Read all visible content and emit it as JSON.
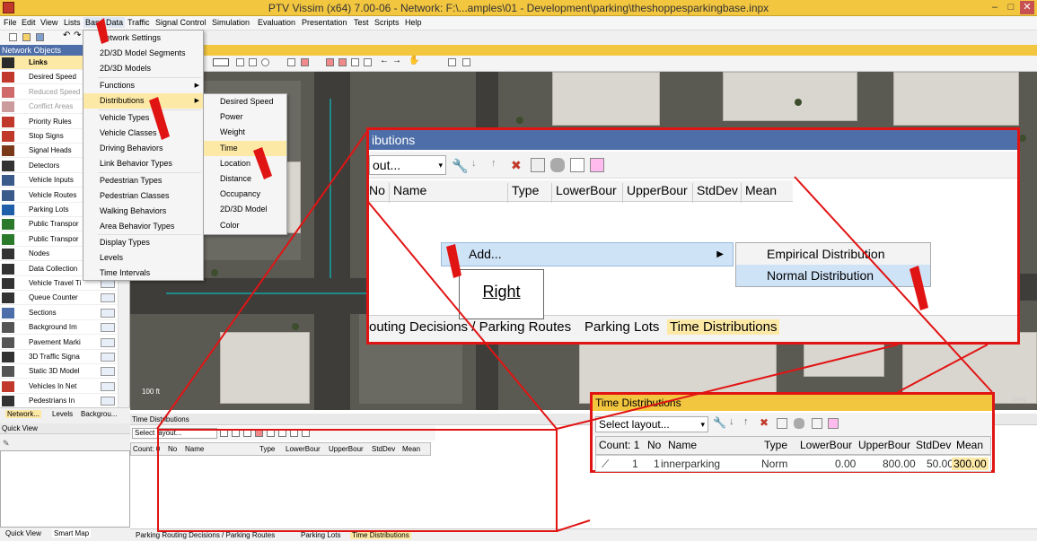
{
  "window": {
    "title": "PTV Vissim (x64) 7.00-06 - Network: F:\\...amples\\01 - Development\\parking\\theshoppesparkingbase.inpx",
    "buttons": [
      "–",
      "□",
      "✕"
    ]
  },
  "menubar": [
    "File",
    "Edit",
    "View",
    "Lists",
    "Base Data",
    "Traffic",
    "Signal Control",
    "Simulation",
    "Evaluation",
    "Presentation",
    "Test",
    "Scripts",
    "Help"
  ],
  "network_objects": {
    "title": "Network Objects",
    "items": [
      {
        "label": "Links",
        "icon": "links-icon",
        "bold": true
      },
      {
        "label": "Desired Speed",
        "icon": "speed-sign-icon"
      },
      {
        "label": "Reduced Speed",
        "icon": "reduced-speed-icon",
        "dim": true
      },
      {
        "label": "Conflict Areas",
        "icon": "conflict-area-icon",
        "dim": true
      },
      {
        "label": "Priority Rules",
        "icon": "priority-rule-icon"
      },
      {
        "label": "Stop Signs",
        "icon": "stop-sign-icon"
      },
      {
        "label": "Signal Heads",
        "icon": "signal-head-icon"
      },
      {
        "label": "Detectors",
        "icon": "detector-icon"
      },
      {
        "label": "Vehicle Inputs",
        "icon": "vehicle-input-icon"
      },
      {
        "label": "Vehicle Routes",
        "icon": "vehicle-route-icon"
      },
      {
        "label": "Parking Lots",
        "icon": "parking-icon"
      },
      {
        "label": "Public Transpor",
        "icon": "public-transport-stop-icon"
      },
      {
        "label": "Public Transpor",
        "icon": "public-transport-line-icon"
      },
      {
        "label": "Nodes",
        "icon": "node-icon"
      },
      {
        "label": "Data Collection",
        "icon": "data-collection-icon"
      },
      {
        "label": "Vehicle Travel Ti",
        "icon": "travel-time-icon"
      },
      {
        "label": "Queue Counter",
        "icon": "queue-counter-icon"
      },
      {
        "label": "Sections",
        "icon": "section-icon"
      },
      {
        "label": "Background Im",
        "icon": "background-image-icon"
      },
      {
        "label": "Pavement Marki",
        "icon": "pavement-marking-icon"
      },
      {
        "label": "3D Traffic Signa",
        "icon": "traffic-signal-3d-icon"
      },
      {
        "label": "Static 3D Model",
        "icon": "static-3d-model-icon"
      },
      {
        "label": "Vehicles In Net",
        "icon": "vehicles-in-net-icon"
      },
      {
        "label": "Pedestrians In",
        "icon": "pedestrians-in-net-icon"
      }
    ],
    "tabs": [
      "Network...",
      "Levels",
      "Backgrou..."
    ]
  },
  "quick_view": {
    "title": "Quick View",
    "tabs": [
      "Quick View",
      "Smart Map"
    ]
  },
  "base_data_menu": {
    "items": [
      {
        "label": "Network Settings"
      },
      {
        "label": "2D/3D Model Segments"
      },
      {
        "label": "2D/3D Models"
      },
      {
        "label": "Functions",
        "submenu": true
      },
      {
        "label": "Distributions",
        "submenu": true,
        "highlighted": true
      },
      {
        "label": "Vehicle Types"
      },
      {
        "label": "Vehicle Classes"
      },
      {
        "label": "Driving Behaviors"
      },
      {
        "label": "Link Behavior Types"
      },
      {
        "label": "Pedestrian Types"
      },
      {
        "label": "Pedestrian Classes"
      },
      {
        "label": "Walking Behaviors"
      },
      {
        "label": "Area Behavior Types"
      },
      {
        "label": "Display Types"
      },
      {
        "label": "Levels"
      },
      {
        "label": "Time Intervals"
      }
    ]
  },
  "distributions_menu": {
    "items": [
      "Desired Speed",
      "Power",
      "Weight",
      "Time",
      "Location",
      "Distance",
      "Occupancy",
      "2D/3D Model",
      "Color"
    ],
    "highlighted": "Time"
  },
  "network_view": {
    "scale": "100 ft",
    "watermark": "bing"
  },
  "bottom_panel": {
    "title": "Time Distributions",
    "layout_placeholder": "Select layout...",
    "columns": [
      "Count: 0",
      "No",
      "Name",
      "Type",
      "LowerBour",
      "UpperBour",
      "StdDev",
      "Mean"
    ],
    "tabs": [
      "Parking Routing Decisions / Parking Routes",
      "Parking Lots",
      "Time Distributions"
    ]
  },
  "zoom_callout": {
    "title": "ibutions",
    "layout_text": "out...",
    "columns": [
      "No",
      "Name",
      "Type",
      "LowerBour",
      "UpperBour",
      "StdDev",
      "Mean"
    ],
    "context_menu": {
      "add": "Add...",
      "submenu": [
        "Empirical Distribution",
        "Normal Distribution"
      ]
    },
    "tabs": [
      "outing Decisions / Parking Routes",
      "Parking Lots",
      "Time Distributions"
    ],
    "annotation": "Right"
  },
  "result_callout": {
    "title": "Time Distributions",
    "layout": "Select layout...",
    "columns": [
      "Count: 1",
      "No",
      "Name",
      "Type",
      "LowerBour",
      "UpperBour",
      "StdDev",
      "Mean"
    ],
    "row": {
      "marker": "⟋",
      "count": "1",
      "no": "1",
      "name": "innerparking",
      "type": "Norm",
      "lower": "0.00",
      "upper": "800.00",
      "stddev": "50.00",
      "mean": "300.00"
    }
  },
  "colors": {
    "title_bar": "#f3c640",
    "panel_header": "#4d6ea8",
    "highlight": "#fde9a6",
    "annotation": "#e11414"
  }
}
